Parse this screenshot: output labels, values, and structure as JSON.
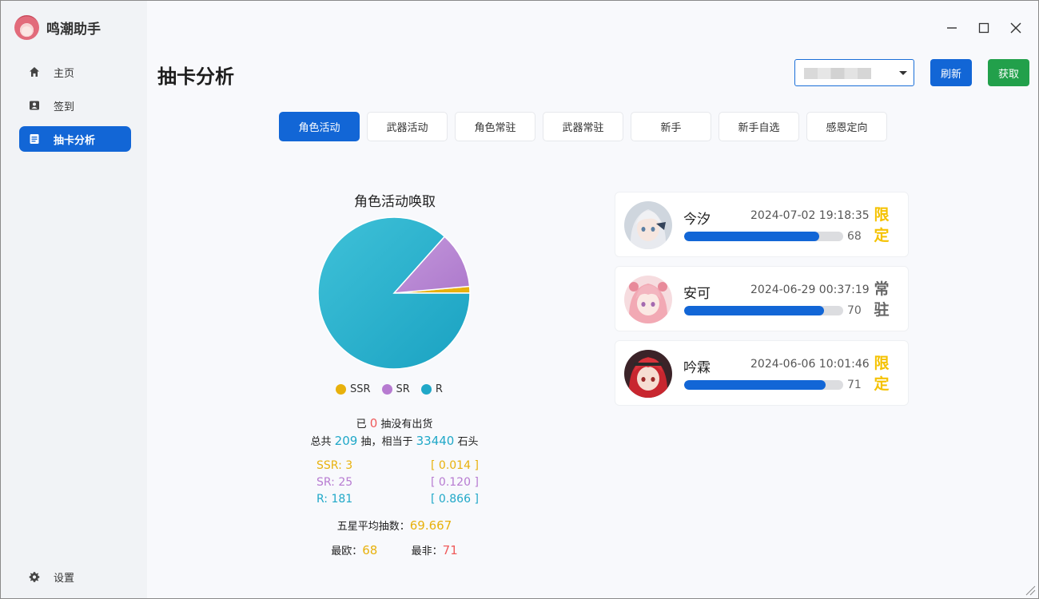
{
  "app": {
    "title": "鸣潮助手"
  },
  "sidebar": {
    "items": [
      {
        "label": "主页",
        "icon": "home-icon"
      },
      {
        "label": "签到",
        "icon": "id-card-icon"
      },
      {
        "label": "抽卡分析",
        "icon": "document-icon"
      }
    ],
    "settings_label": "设置"
  },
  "header": {
    "title": "抽卡分析",
    "refresh_label": "刷新",
    "fetch_label": "获取"
  },
  "tabs": [
    "角色活动",
    "武器活动",
    "角色常驻",
    "武器常驻",
    "新手",
    "新手自选",
    "感恩定向"
  ],
  "chart_data": {
    "type": "pie",
    "title": "角色活动唤取",
    "categories": [
      "SSR",
      "SR",
      "R"
    ],
    "values": [
      3,
      25,
      181
    ],
    "colors": [
      "#e8b10c",
      "#b77bd1",
      "#20a8c8"
    ],
    "legend_position": "bottom"
  },
  "stats": {
    "no_drop_prefix": "已",
    "no_drop_count": "0",
    "no_drop_suffix": "抽没有出货",
    "total_prefix": "总共",
    "total_pulls": "209",
    "total_mid": "抽，相当于",
    "total_stones": "33440",
    "total_suffix": "石头",
    "ssr_label": "SSR: 3",
    "ssr_ratio": "[ 0.014 ]",
    "sr_label": "SR: 25",
    "sr_ratio": "[ 0.120 ]",
    "r_label": "R: 181",
    "r_ratio": "[ 0.866 ]",
    "avg_label": "五星平均抽数：",
    "avg_value": "69.667",
    "best_label": "最欧：",
    "best_value": "68",
    "worst_label": "最非：",
    "worst_value": "71"
  },
  "records": [
    {
      "name": "今汐",
      "time": "2024-07-02 19:18:35",
      "count": "68",
      "progress": 0.85,
      "tag_line1": "限",
      "tag_line2": "定",
      "tag_type": "limited"
    },
    {
      "name": "安可",
      "time": "2024-06-29 00:37:19",
      "count": "70",
      "progress": 0.88,
      "tag_line1": "常",
      "tag_line2": "驻",
      "tag_type": "standard"
    },
    {
      "name": "吟霖",
      "time": "2024-06-06 10:01:46",
      "count": "71",
      "progress": 0.89,
      "tag_line1": "限",
      "tag_line2": "定",
      "tag_type": "limited"
    }
  ]
}
